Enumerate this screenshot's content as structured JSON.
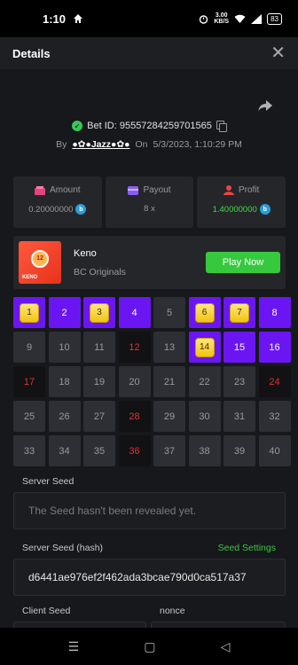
{
  "status_bar": {
    "time": "1:10",
    "speed_value": "3.00",
    "speed_unit": "KB/S",
    "battery": "83"
  },
  "header": {
    "title": "Details",
    "close": "✕"
  },
  "bet": {
    "id_label": "Bet ID: 95557284259701565",
    "by_label": "By",
    "user": "●✿●Jazz●✿●",
    "on_label": "On",
    "datetime": "5/3/2023, 1:10:29 PM"
  },
  "stats": {
    "amount_label": "Amount",
    "amount_value": "0.20000000",
    "payout_label": "Payout",
    "payout_value": "8 x",
    "profit_label": "Profit",
    "profit_value": "1.40000000"
  },
  "game": {
    "name": "Keno",
    "provider": "BC Originals",
    "play_label": "Play Now",
    "thumb_tag": "KENO",
    "thumb_ball": "12"
  },
  "grid": {
    "selected_hit": [
      "1",
      "3",
      "6",
      "7",
      "14"
    ],
    "selected": [
      "2",
      "4",
      "8",
      "15",
      "16"
    ],
    "drawn_miss": [
      "12",
      "17",
      "24",
      "28",
      "36"
    ],
    "numbers": [
      "1",
      "2",
      "3",
      "4",
      "5",
      "6",
      "7",
      "8",
      "9",
      "10",
      "11",
      "12",
      "13",
      "14",
      "15",
      "16",
      "17",
      "18",
      "19",
      "20",
      "21",
      "22",
      "23",
      "24",
      "25",
      "26",
      "27",
      "28",
      "29",
      "30",
      "31",
      "32",
      "33",
      "34",
      "35",
      "36",
      "37",
      "38",
      "39",
      "40"
    ]
  },
  "seeds": {
    "server_seed_label": "Server Seed",
    "server_seed_placeholder": "The Seed hasn't been revealed yet.",
    "server_hash_label": "Server Seed (hash)",
    "seed_settings_label": "Seed Settings",
    "server_hash_value": "d6441ae976ef2f462ada3bcae790d0ca517a37",
    "client_seed_label": "Client Seed",
    "nonce_label": "nonce"
  },
  "colors": {
    "accent_green": "#36c93d",
    "selected_purple": "#6b16f2",
    "miss_red": "#e03232",
    "gem_gold": "#f1c40f"
  }
}
